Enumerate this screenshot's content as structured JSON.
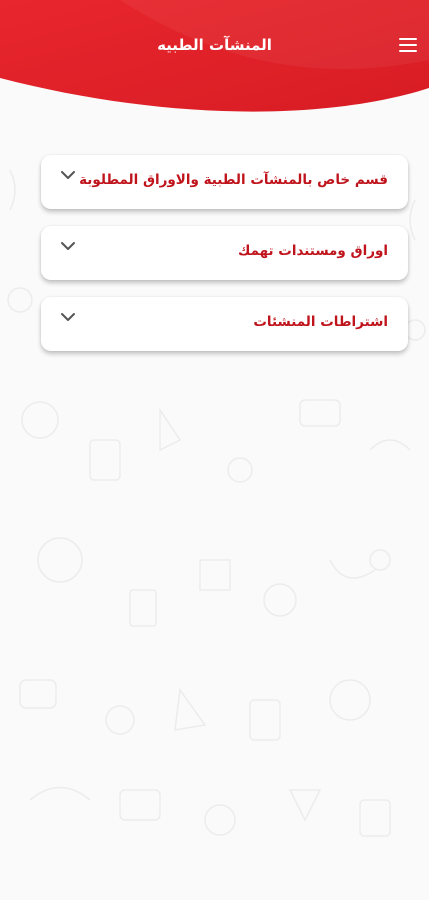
{
  "app": {
    "title": "المنشآت الطبيه"
  },
  "header": {
    "menu_icon": "hamburger-menu-icon",
    "color": "#e02329"
  },
  "sections": [
    {
      "label": "قسم خاص بالمنشآت الطبية والاوراق المطلوبة",
      "icon": "chevron-down-icon"
    },
    {
      "label": "اوراق ومستندات تهمك",
      "icon": "chevron-down-icon"
    },
    {
      "label": "اشتراطات المنشئات",
      "icon": "chevron-down-icon"
    }
  ],
  "colors": {
    "accent": "#e02329",
    "label": "#c0141c",
    "background": "#fafafa"
  }
}
